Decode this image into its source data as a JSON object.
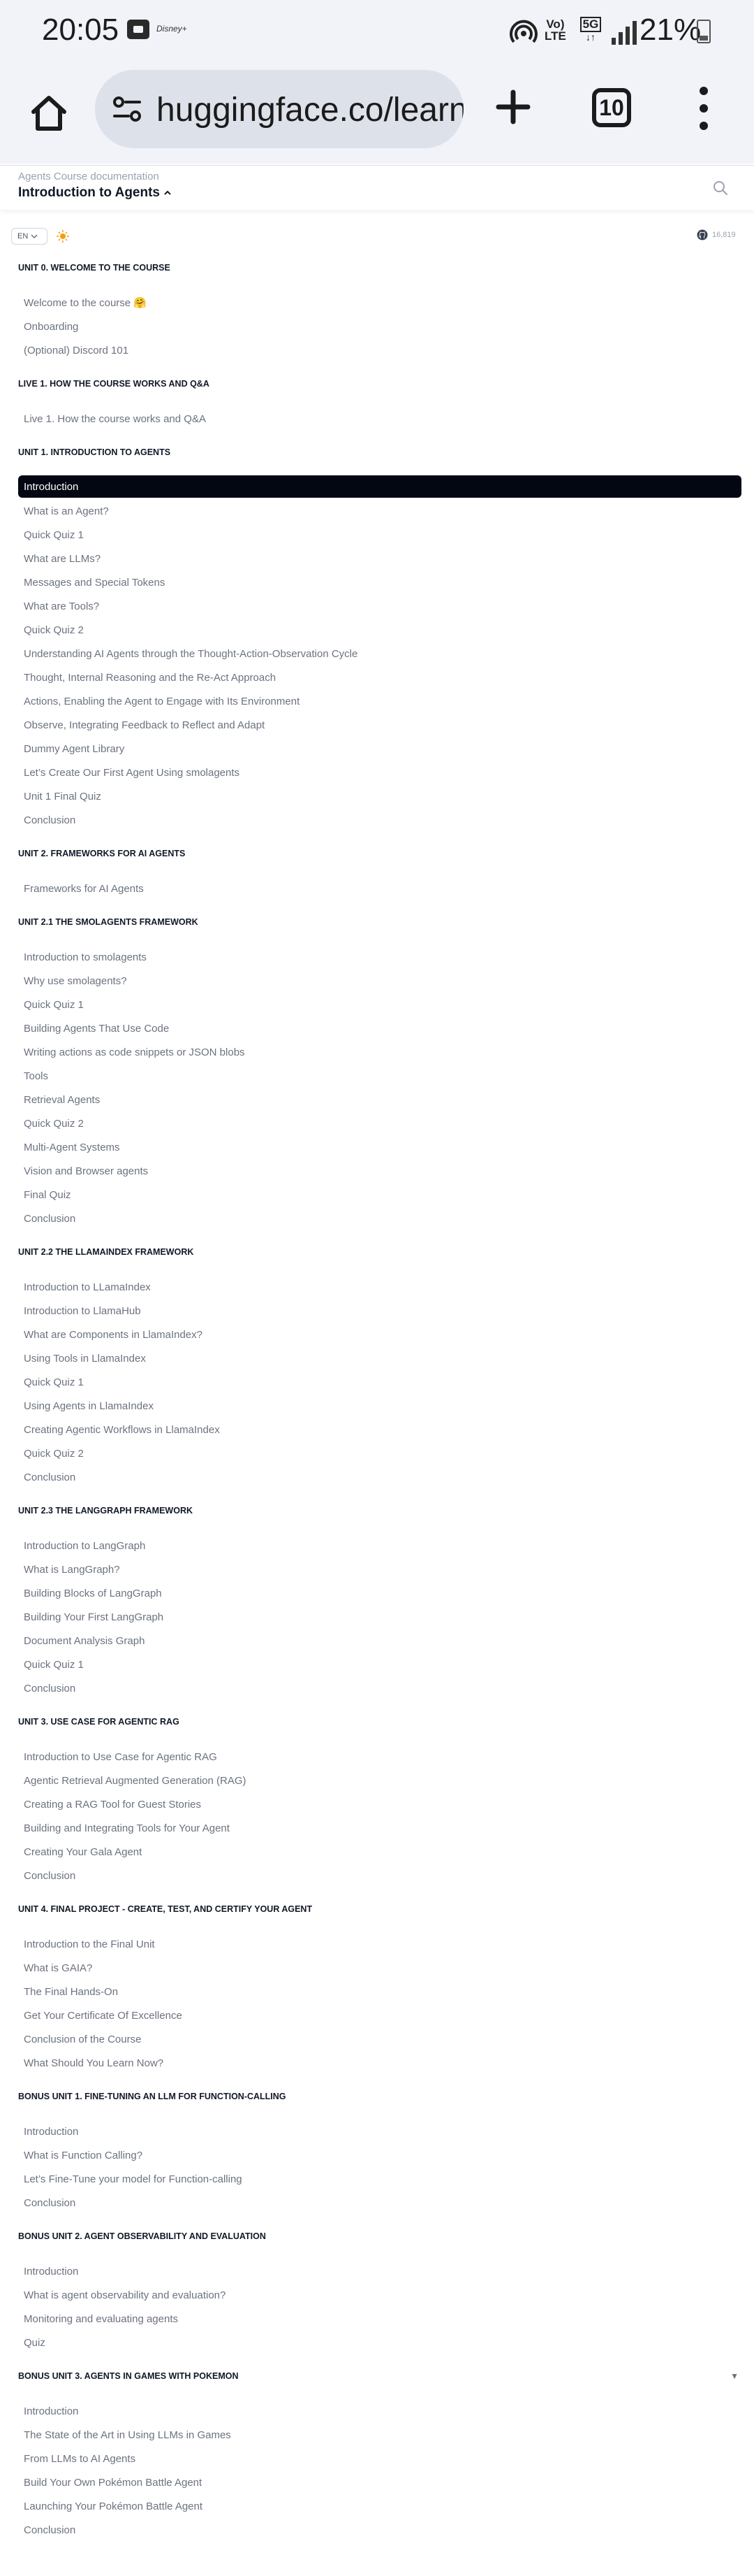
{
  "status_bar": {
    "time": "20:05",
    "disney_label": "Disney+",
    "volte": [
      "Vo)",
      "LTE"
    ],
    "network": "5G",
    "battery": "21%",
    "icons": [
      "gallery-icon",
      "hotspot-icon",
      "signal-icon",
      "battery-icon"
    ]
  },
  "browser": {
    "url": "huggingface.co/learn",
    "tab_count": "10",
    "icons": [
      "home-icon",
      "site-settings-icon",
      "new-tab-icon",
      "tabs-icon",
      "menu-icon"
    ]
  },
  "header": {
    "subtitle": "Agents Course documentation",
    "title": "Introduction to Agents",
    "title_caret": "^"
  },
  "toolbar": {
    "language": "EN",
    "github_stars": "16,819"
  },
  "sections": [
    {
      "title": "Unit 0. Welcome to the course",
      "items": [
        "Welcome to the course 🤗",
        "Onboarding",
        "(Optional) Discord 101"
      ]
    },
    {
      "title": "Live 1. How the course works and Q&A",
      "items": [
        "Live 1. How the course works and Q&A"
      ]
    },
    {
      "title": "Unit 1. Introduction to Agents",
      "items": [
        "Introduction",
        "What is an Agent?",
        "Quick Quiz 1",
        "What are LLMs?",
        "Messages and Special Tokens",
        "What are Tools?",
        "Quick Quiz 2",
        "Understanding AI Agents through the Thought-Action-Observation Cycle",
        "Thought, Internal Reasoning and the Re-Act Approach",
        "Actions, Enabling the Agent to Engage with Its Environment",
        "Observe, Integrating Feedback to Reflect and Adapt",
        "Dummy Agent Library",
        "Let’s Create Our First Agent Using smolagents",
        "Unit 1 Final Quiz",
        "Conclusion"
      ]
    },
    {
      "title": "Unit 2. Frameworks for AI Agents",
      "items": [
        "Frameworks for AI Agents"
      ]
    },
    {
      "title": "Unit 2.1 The smolagents framework",
      "items": [
        "Introduction to smolagents",
        "Why use smolagents?",
        "Quick Quiz 1",
        "Building Agents That Use Code",
        "Writing actions as code snippets or JSON blobs",
        "Tools",
        "Retrieval Agents",
        "Quick Quiz 2",
        "Multi-Agent Systems",
        "Vision and Browser agents",
        "Final Quiz",
        "Conclusion"
      ]
    },
    {
      "title": "Unit 2.2 The LlamaIndex framework",
      "items": [
        "Introduction to LLamaIndex",
        "Introduction to LlamaHub",
        "What are Components in LlamaIndex?",
        "Using Tools in LlamaIndex",
        "Quick Quiz 1",
        "Using Agents in LlamaIndex",
        "Creating Agentic Workflows in LlamaIndex",
        "Quick Quiz 2",
        "Conclusion"
      ]
    },
    {
      "title": "Unit 2.3 The LangGraph framework",
      "items": [
        "Introduction to LangGraph",
        "What is LangGraph?",
        "Building Blocks of LangGraph",
        "Building Your First LangGraph",
        "Document Analysis Graph",
        "Quick Quiz 1",
        "Conclusion"
      ]
    },
    {
      "title": "Unit 3. Use Case for Agentic RAG",
      "items": [
        "Introduction to Use Case for Agentic RAG",
        "Agentic Retrieval Augmented Generation (RAG)",
        "Creating a RAG Tool for Guest Stories",
        "Building and Integrating Tools for Your Agent",
        "Creating Your Gala Agent",
        "Conclusion"
      ]
    },
    {
      "title": "Unit 4. Final Project - Create, Test, and Certify Your Agent",
      "items": [
        "Introduction to the Final Unit",
        "What is GAIA?",
        "The Final Hands-On",
        "Get Your Certificate Of Excellence",
        "Conclusion of the Course",
        "What Should You Learn Now?"
      ]
    },
    {
      "title": "Bonus Unit 1. Fine-tuning an LLM for Function-calling",
      "items": [
        "Introduction",
        "What is Function Calling?",
        "Let’s Fine-Tune your model for Function-calling",
        "Conclusion"
      ]
    },
    {
      "title": "Bonus Unit 2. Agent Observability and Evaluation",
      "items": [
        "Introduction",
        "What is agent observability and evaluation?",
        "Monitoring and evaluating agents",
        "Quiz"
      ]
    },
    {
      "title": "Bonus Unit 3. Agents in Games with Pokemon",
      "caret": "▼",
      "items": [
        "Introduction",
        "The State of the Art in Using LLMs in Games",
        "From LLMs to AI Agents",
        "Build Your Own Pokémon Battle Agent",
        "Launching Your Pokémon Battle Agent",
        "Conclusion"
      ]
    }
  ]
}
